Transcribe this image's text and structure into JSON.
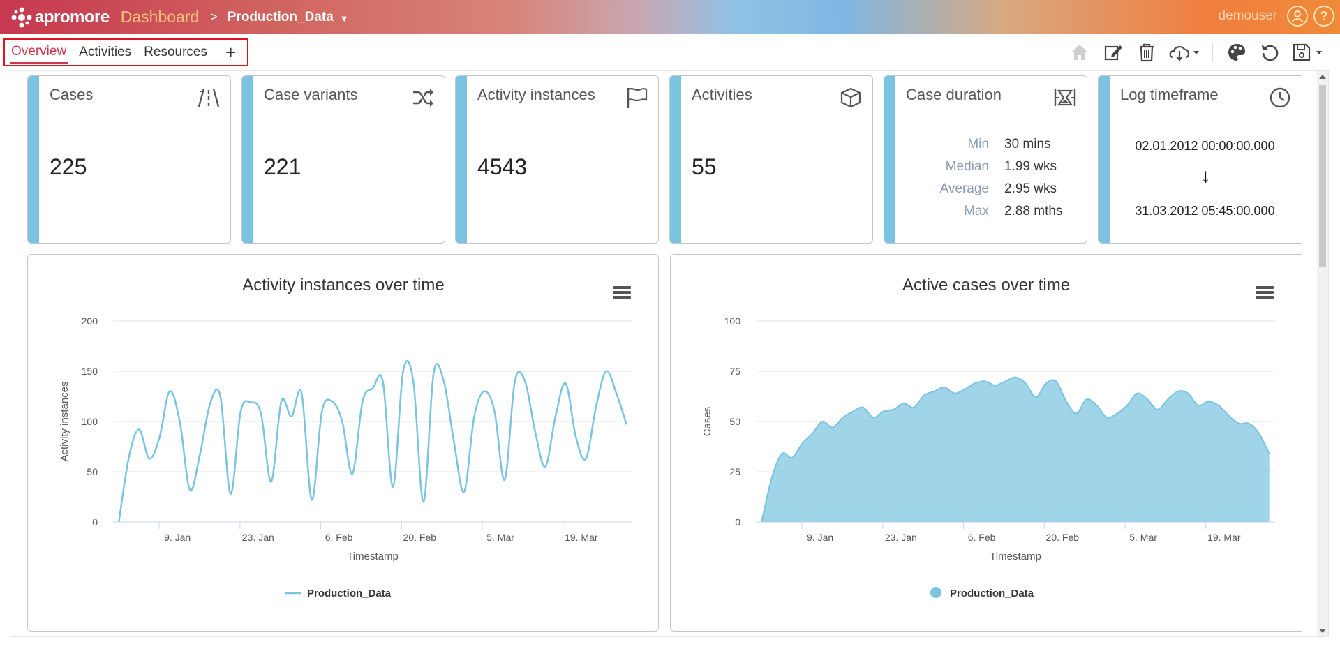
{
  "header": {
    "brand": "apromore",
    "section": "Dashboard",
    "separator": ">",
    "log_name": "Production_Data",
    "user": "demouser"
  },
  "tabs": {
    "items": [
      {
        "label": "Overview",
        "active": true
      },
      {
        "label": "Activities",
        "active": false
      },
      {
        "label": "Resources",
        "active": false
      }
    ],
    "add_label": "+"
  },
  "toolbar": {
    "icons": [
      "home-icon",
      "edit-icon",
      "delete-icon",
      "download-icon",
      "palette-icon",
      "reset-icon",
      "save-icon"
    ]
  },
  "kpis": {
    "cases": {
      "title": "Cases",
      "value": "225",
      "icon": "road-icon"
    },
    "variants": {
      "title": "Case variants",
      "value": "221",
      "icon": "shuffle-icon"
    },
    "instances": {
      "title": "Activity instances",
      "value": "4543",
      "icon": "flag-icon"
    },
    "activities": {
      "title": "Activities",
      "value": "55",
      "icon": "cube-icon"
    },
    "duration": {
      "title": "Case duration",
      "icon": "hourglass-icon",
      "rows": [
        {
          "label": "Min",
          "value": "30 mins"
        },
        {
          "label": "Median",
          "value": "1.99 wks"
        },
        {
          "label": "Average",
          "value": "2.95 wks"
        },
        {
          "label": "Max",
          "value": "2.88 mths"
        }
      ]
    },
    "timeframe": {
      "title": "Log timeframe",
      "icon": "clock-icon",
      "start": "02.01.2012 00:00:00.000",
      "arrow": "↓",
      "end": "31.03.2012 05:45:00.000"
    }
  },
  "colors": {
    "accent": "#c6384f",
    "card_bar": "#7ac3e1",
    "series": "#7ac3e1"
  },
  "chart_data": [
    {
      "type": "line",
      "title": "Activity instances over time",
      "xlabel": "Timestamp",
      "ylabel": "Activity instances",
      "ylim": [
        0,
        200
      ],
      "yticks": [
        "0",
        "50",
        "100",
        "150",
        "200"
      ],
      "xticks": [
        "9. Jan",
        "23. Jan",
        "6. Feb",
        "20. Feb",
        "5. Mar",
        "19. Mar"
      ],
      "xtick_days": [
        7,
        21,
        35,
        49,
        63,
        77
      ],
      "xlim_days": [
        -1,
        89
      ],
      "legend": "bottom-center",
      "series": [
        {
          "name": "Production_Data",
          "x_days": [
            0,
            1,
            2,
            3,
            4,
            5,
            6,
            7,
            8,
            9,
            10,
            11,
            12,
            13,
            14,
            15,
            16,
            17,
            18,
            19,
            20,
            21,
            22,
            23,
            24,
            25,
            26,
            27,
            28,
            29,
            30,
            31,
            32,
            33,
            34,
            35,
            36,
            37,
            38,
            39,
            40,
            41,
            42,
            43,
            44,
            45,
            46,
            47,
            48,
            49,
            50,
            51,
            52,
            53,
            54,
            55,
            56,
            57,
            58,
            59,
            60,
            61,
            62,
            63,
            64,
            65,
            66,
            67,
            68,
            69,
            70,
            71,
            72,
            73,
            74,
            75,
            76,
            77,
            78,
            79,
            80,
            81,
            82,
            83,
            84,
            85,
            86,
            87,
            88
          ],
          "values": [
            0,
            65,
            92,
            63,
            84,
            130,
            100,
            32,
            68,
            118,
            125,
            28,
            110,
            119,
            108,
            40,
            120,
            105,
            128,
            22,
            110,
            120,
            100,
            48,
            120,
            133,
            140,
            35,
            150,
            140,
            20,
            148,
            140,
            80,
            30,
            105,
            130,
            110,
            42,
            140,
            140,
            90,
            55,
            105,
            138,
            85,
            63,
            115,
            150,
            128,
            97
          ]
        }
      ]
    },
    {
      "type": "area",
      "title": "Active cases over time",
      "xlabel": "Timestamp",
      "ylabel": "Cases",
      "ylim": [
        0,
        100
      ],
      "yticks": [
        "0",
        "25",
        "50",
        "75",
        "100"
      ],
      "xticks": [
        "9. Jan",
        "23. Jan",
        "6. Feb",
        "20. Feb",
        "5. Mar",
        "19. Mar"
      ],
      "xtick_days": [
        7,
        21,
        35,
        49,
        63,
        77
      ],
      "xlim_days": [
        -1,
        89
      ],
      "legend": "bottom-center",
      "series": [
        {
          "name": "Production_Data",
          "values": [
            0,
            22,
            34,
            32,
            39,
            44,
            50,
            47,
            52,
            55,
            57,
            52,
            55,
            56,
            59,
            57,
            63,
            65,
            67,
            64,
            66,
            69,
            70,
            68,
            70,
            72,
            69,
            62,
            69,
            70,
            60,
            54,
            61,
            58,
            52,
            54,
            58,
            64,
            61,
            56,
            61,
            65,
            64,
            58,
            60,
            58,
            53,
            49,
            49,
            44,
            34
          ]
        }
      ]
    }
  ]
}
